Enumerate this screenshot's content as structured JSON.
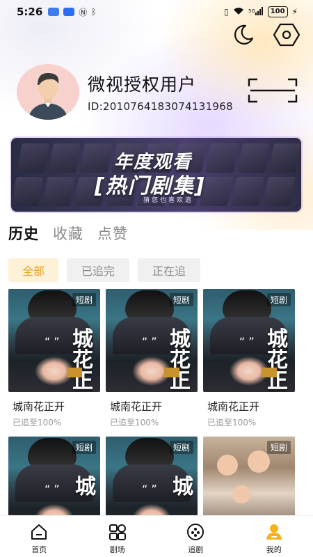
{
  "status_bar": {
    "time": "5:26",
    "battery": "100",
    "network": "5G"
  },
  "top_actions": {
    "theme_icon": "moon-icon",
    "settings_icon": "hexagon-settings-icon"
  },
  "profile": {
    "name": "微视授权用户",
    "id_text": "ID:2010764183074131968",
    "avatar_icon": "user-avatar"
  },
  "scan_icon": "scan-icon",
  "banner": {
    "title_line1": "年度观看",
    "title_line2": "[热门剧集]",
    "subtitle": "猜您也喜欢追"
  },
  "tabs": [
    {
      "label": "历史",
      "active": true
    },
    {
      "label": "收藏",
      "active": false
    },
    {
      "label": "点赞",
      "active": false
    }
  ],
  "filters": [
    {
      "label": "全部",
      "active": true
    },
    {
      "label": "已追完",
      "active": false
    },
    {
      "label": "正在追",
      "active": false
    }
  ],
  "cards": [
    {
      "title": "城南花正开",
      "progress": "已追至100%",
      "badge": "短剧",
      "poster_text": "城花正开"
    },
    {
      "title": "城南花正开",
      "progress": "已追至100%",
      "badge": "短剧",
      "poster_text": "城花正开"
    },
    {
      "title": "城南花正开",
      "progress": "已追至100%",
      "badge": "短剧",
      "poster_text": "城花正开"
    },
    {
      "badge": "短剧",
      "poster_text": "城"
    },
    {
      "badge": "短剧",
      "poster_text": "城"
    },
    {
      "badge": "短剧"
    }
  ],
  "bottom_nav": [
    {
      "label": "首页",
      "icon": "home-icon",
      "active": false
    },
    {
      "label": "剧场",
      "icon": "theater-icon",
      "active": false
    },
    {
      "label": "追剧",
      "icon": "follow-icon",
      "active": false
    },
    {
      "label": "我的",
      "icon": "profile-icon",
      "active": true
    }
  ],
  "colors": {
    "accent": "#f0a12a",
    "chip_active_bg": "#fdf1d8",
    "chip_bg": "#f0f0f0",
    "nav_active": "#f5b21a"
  }
}
